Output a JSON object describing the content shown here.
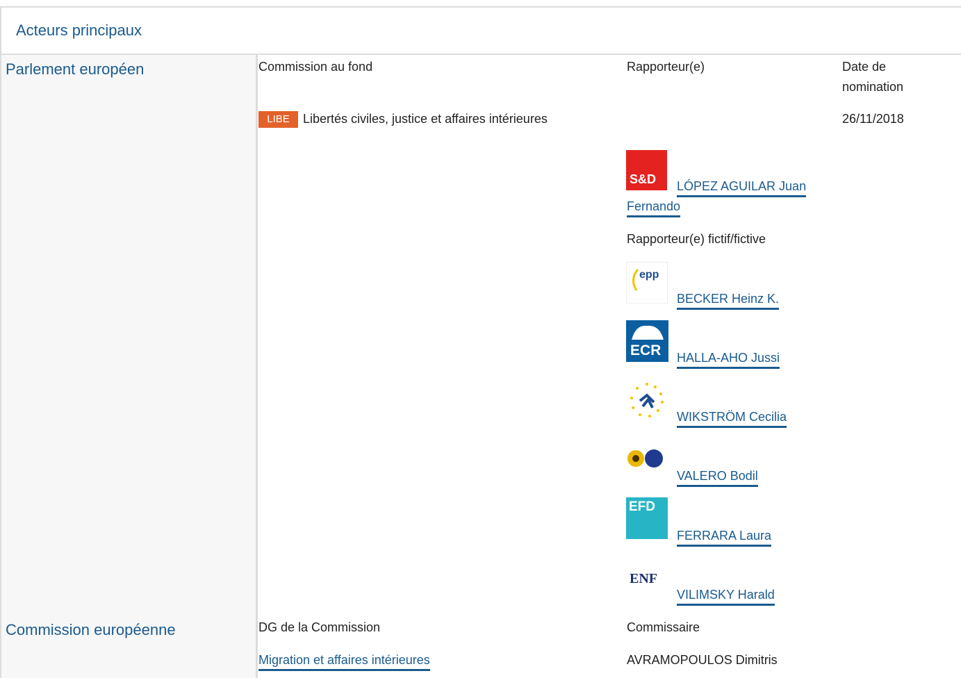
{
  "header": {
    "title": "Acteurs principaux"
  },
  "parliament": {
    "title": "Parlement européen",
    "col_committee": "Commission au fond",
    "col_rapporteur": "Rapporteur(e)",
    "col_date_line1": "Date de",
    "col_date_line2": "nomination",
    "committee_code": "LIBE",
    "committee_name": "Libertés civiles, justice et affaires intérieures",
    "date": "26/11/2018",
    "rapporteur_line1": "LÓPEZ AGUILAR Juan",
    "rapporteur_line2": "Fernando",
    "shadow_label": "Rapporteur(e) fictif/fictive",
    "shadows": [
      "BECKER Heinz K.",
      "HALLA-AHO Jussi",
      "WIKSTRÖM Cecilia",
      "VALERO Bodil",
      "FERRARA Laura",
      "VILIMSKY Harald"
    ],
    "logos": {
      "sd": "S&D",
      "epp": "epp",
      "ecr": "ECR",
      "efd": "EFD",
      "enf": "ENF"
    }
  },
  "commission": {
    "title": "Commission européenne",
    "col_dg": "DG de la Commission",
    "col_commissioner": "Commissaire",
    "dg": "Migration et affaires intérieures",
    "commissioner": "AVRAMOPOULOS Dimitris"
  },
  "colors": {
    "accent": "#1a5b8f",
    "libe": "#e2622a"
  }
}
